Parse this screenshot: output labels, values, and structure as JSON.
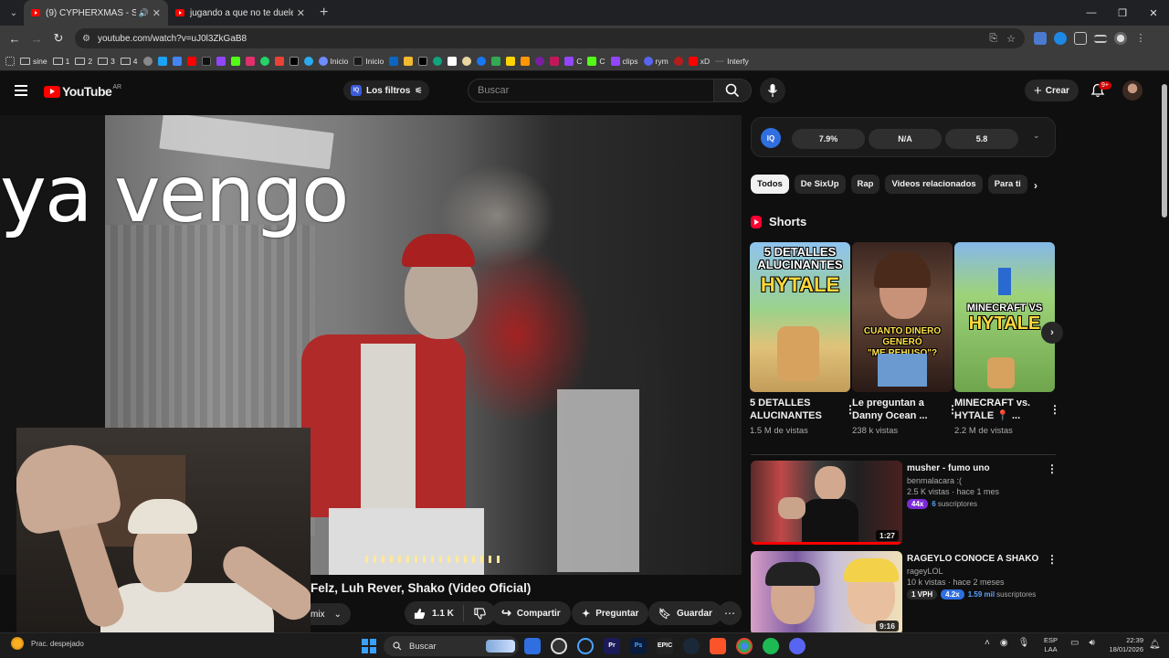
{
  "browser": {
    "tabs": [
      {
        "title": "(9) CYPHERXMAS - SixUp, J",
        "audio": "🔊",
        "active": true
      },
      {
        "title": "jugando a que no te duele nad",
        "active": false
      }
    ],
    "new_tab": "+",
    "url": "youtube.com/watch?v=uJ0l3ZkGaB8",
    "bookmarks": [
      "sine",
      "1",
      "2",
      "3",
      "4",
      "Inicio",
      "Inicio",
      "C",
      "C",
      "clips",
      "rym",
      "xD",
      "Interfy"
    ]
  },
  "youtube": {
    "logo_text": "YouTube",
    "region": "AR",
    "filters_label": "Los filtros",
    "search_placeholder": "Buscar",
    "create_label": "Crear",
    "notif_badge": "9+"
  },
  "player": {
    "overlay_text": "ya vengo",
    "title_fragment": "Felz, Luh Rever, Shako (Video Oficial)",
    "mix_label": "mix",
    "like_count": "1.1 K",
    "share_label": "Compartir",
    "ask_label": "Preguntar",
    "save_label": "Guardar"
  },
  "iq_stats": {
    "logo": "IQ",
    "values": [
      "7.9%",
      "N/A",
      "5.8"
    ]
  },
  "chips": [
    "Todos",
    "De SixUp",
    "Rap",
    "Videos relacionados",
    "Para ti"
  ],
  "shorts": {
    "heading": "Shorts",
    "items": [
      {
        "thumb_text": "5 DETALLES ALUCINANTES HYTALE",
        "title": "5 DETALLES ALUCINANTES ...",
        "views": "1.5 M de vistas"
      },
      {
        "thumb_text": "CUANTO DINERO GENERÓ \"ME REHUSO\"?",
        "title": "Le preguntan a Danny Ocean ...",
        "views": "238 k vistas"
      },
      {
        "thumb_text": "MINECRAFT VS HYTALE",
        "title": "MINECRAFT vs. HYTALE 📍 ...",
        "views": "2.2 M de vistas"
      }
    ]
  },
  "recommended": [
    {
      "title": "musher - fumo uno",
      "channel": "benmalacara :(",
      "meta": "2.5 K vistas · hace 1 mes",
      "duration": "1:27",
      "badge1": "44x",
      "badge2_num": "6",
      "badge2_label": "suscriptores"
    },
    {
      "title": "RAGEYLO CONOCE A SHAKO",
      "channel": "rageyLOL",
      "meta": "10 k vistas · hace 2 meses",
      "duration": "9:16",
      "badge0": "1 VPH",
      "badge1": "4.2x",
      "badge2_num": "1.59 mil",
      "badge2_label": "suscriptores"
    }
  ],
  "taskbar": {
    "weather": "Prac. despejado",
    "search_label": "Buscar",
    "lang_top": "ESP",
    "lang_bottom": "LAA",
    "time": "22:39",
    "date": "18/01/2026"
  }
}
